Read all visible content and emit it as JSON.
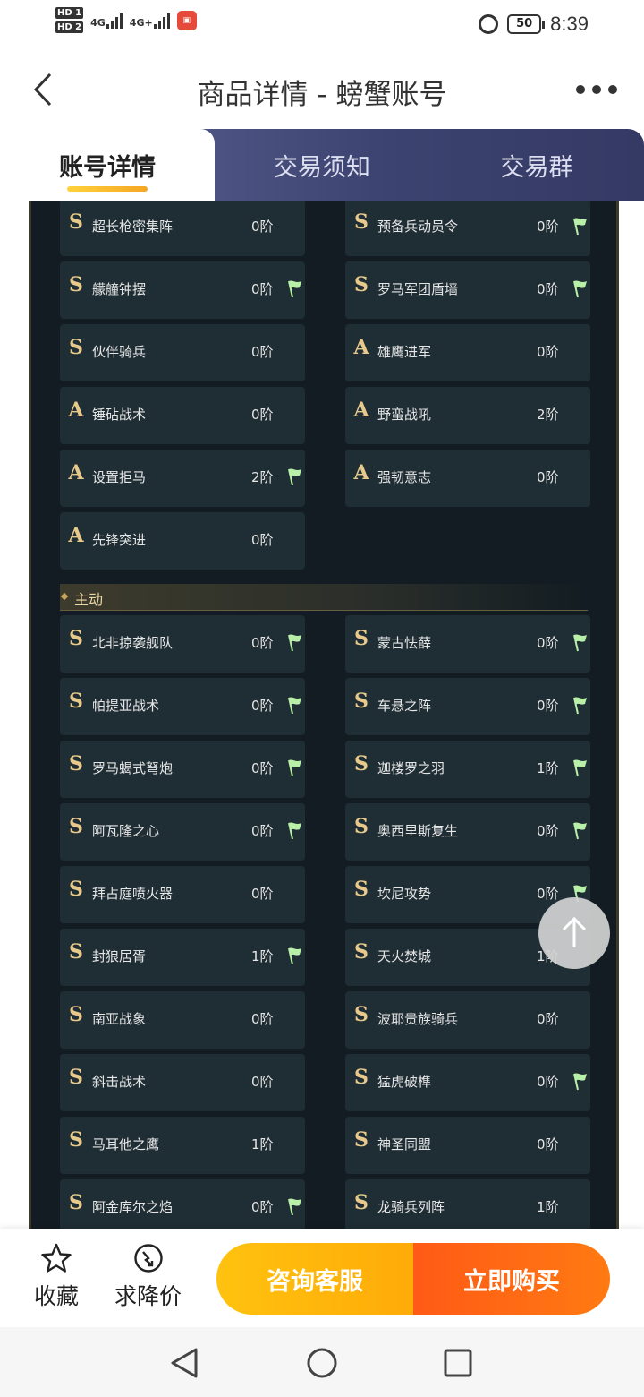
{
  "status_bar": {
    "hd1": "HD 1",
    "hd2": "HD 2",
    "net1": "4G",
    "net2": "4G+",
    "battery": "50",
    "time": "8:39"
  },
  "header": {
    "title": "商品详情 - 螃蟹账号"
  },
  "tabs": [
    {
      "label": "账号详情",
      "active": true
    },
    {
      "label": "交易须知",
      "active": false
    },
    {
      "label": "交易群",
      "active": false
    }
  ],
  "colors": {
    "accent_yellow": "#ffc20f",
    "accent_orange": "#ff5a16",
    "panel_bg": "#121c22",
    "cell_bg": "#1f2d34",
    "gold": "#e7c98b",
    "flag_green": "#b8f0a8"
  },
  "passive_items": [
    {
      "grade": "S",
      "name": "超长枪密集阵",
      "level": "0阶",
      "flag": false
    },
    {
      "grade": "S",
      "name": "预备兵动员令",
      "level": "0阶",
      "flag": true
    },
    {
      "grade": "S",
      "name": "艨艟钟摆",
      "level": "0阶",
      "flag": true
    },
    {
      "grade": "S",
      "name": "罗马军团盾墙",
      "level": "0阶",
      "flag": true
    },
    {
      "grade": "S",
      "name": "伙伴骑兵",
      "level": "0阶",
      "flag": false
    },
    {
      "grade": "A",
      "name": "雄鹰进军",
      "level": "0阶",
      "flag": false
    },
    {
      "grade": "A",
      "name": "锤砧战术",
      "level": "0阶",
      "flag": false
    },
    {
      "grade": "A",
      "name": "野蛮战吼",
      "level": "2阶",
      "flag": false
    },
    {
      "grade": "A",
      "name": "设置拒马",
      "level": "2阶",
      "flag": true
    },
    {
      "grade": "A",
      "name": "强韧意志",
      "level": "0阶",
      "flag": false
    },
    {
      "grade": "A",
      "name": "先锋突进",
      "level": "0阶",
      "flag": false
    }
  ],
  "section_label": "主动",
  "active_items": [
    {
      "grade": "S",
      "name": "北非掠袭舰队",
      "level": "0阶",
      "flag": true
    },
    {
      "grade": "S",
      "name": "蒙古怯薛",
      "level": "0阶",
      "flag": true
    },
    {
      "grade": "S",
      "name": "帕提亚战术",
      "level": "0阶",
      "flag": true
    },
    {
      "grade": "S",
      "name": "车悬之阵",
      "level": "0阶",
      "flag": true
    },
    {
      "grade": "S",
      "name": "罗马蝎式弩炮",
      "level": "0阶",
      "flag": true
    },
    {
      "grade": "S",
      "name": "迦楼罗之羽",
      "level": "1阶",
      "flag": true
    },
    {
      "grade": "S",
      "name": "阿瓦隆之心",
      "level": "0阶",
      "flag": true
    },
    {
      "grade": "S",
      "name": "奥西里斯复生",
      "level": "0阶",
      "flag": true
    },
    {
      "grade": "S",
      "name": "拜占庭喷火器",
      "level": "0阶",
      "flag": false
    },
    {
      "grade": "S",
      "name": "坎尼攻势",
      "level": "0阶",
      "flag": true
    },
    {
      "grade": "S",
      "name": "封狼居胥",
      "level": "1阶",
      "flag": true
    },
    {
      "grade": "S",
      "name": "天火焚城",
      "level": "1阶",
      "flag": false
    },
    {
      "grade": "S",
      "name": "南亚战象",
      "level": "0阶",
      "flag": false
    },
    {
      "grade": "S",
      "name": "波耶贵族骑兵",
      "level": "0阶",
      "flag": false
    },
    {
      "grade": "S",
      "name": "斜击战术",
      "level": "0阶",
      "flag": false
    },
    {
      "grade": "S",
      "name": "猛虎破榫",
      "level": "0阶",
      "flag": true
    },
    {
      "grade": "S",
      "name": "马耳他之鹰",
      "level": "1阶",
      "flag": false
    },
    {
      "grade": "S",
      "name": "神圣同盟",
      "level": "0阶",
      "flag": false
    },
    {
      "grade": "S",
      "name": "阿金库尔之焰",
      "level": "0阶",
      "flag": true
    },
    {
      "grade": "S",
      "name": "龙骑兵列阵",
      "level": "1阶",
      "flag": false
    }
  ],
  "bottom_bar": {
    "favorite_label": "收藏",
    "price_drop_label": "求降价",
    "consult_label": "咨询客服",
    "buy_label": "立即购买"
  }
}
